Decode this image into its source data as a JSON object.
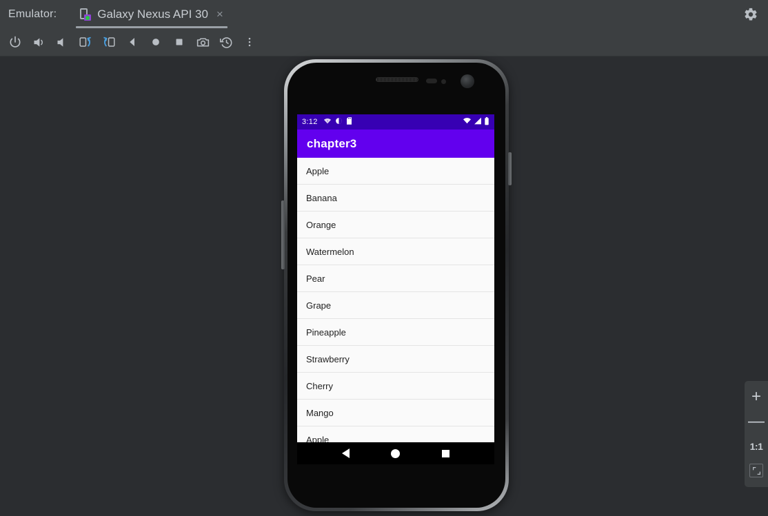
{
  "window": {
    "emulator_label": "Emulator:",
    "tab_title": "Galaxy Nexus API 30",
    "tab_close_glyph": "×",
    "device_icon_name": "device-running-icon",
    "settings_icon_name": "gear-icon"
  },
  "toolbar": {
    "buttons": [
      {
        "name": "power-button",
        "tooltip": "Power"
      },
      {
        "name": "volume-up-button",
        "tooltip": "Volume Up"
      },
      {
        "name": "volume-down-button",
        "tooltip": "Volume Down"
      },
      {
        "name": "rotate-left-button",
        "tooltip": "Rotate Left"
      },
      {
        "name": "rotate-right-button",
        "tooltip": "Rotate Right"
      },
      {
        "name": "back-button",
        "tooltip": "Back"
      },
      {
        "name": "home-button",
        "tooltip": "Home"
      },
      {
        "name": "overview-button",
        "tooltip": "Overview"
      },
      {
        "name": "screenshot-button",
        "tooltip": "Take Screenshot"
      },
      {
        "name": "record-history-button",
        "tooltip": "Record and Playback"
      },
      {
        "name": "more-options-button",
        "tooltip": "More"
      }
    ]
  },
  "device": {
    "status_bar": {
      "clock": "3:12",
      "left_icons": [
        "wifi-unknown-icon",
        "do-not-disturb-icon",
        "sd-card-icon"
      ],
      "right_icons": [
        "wifi-no-internet-icon",
        "cellular-signal-icon",
        "battery-icon"
      ],
      "background_color": "#3700b3"
    },
    "app_bar": {
      "title": "chapter3",
      "background_color": "#6200ee",
      "text_color": "#ffffff"
    },
    "list": {
      "items": [
        "Apple",
        "Banana",
        "Orange",
        "Watermelon",
        "Pear",
        "Grape",
        "Pineapple",
        "Strawberry",
        "Cherry",
        "Mango",
        "Apple"
      ],
      "background_color": "#fafafa",
      "divider_color": "#e4e4e4"
    },
    "nav_bar": {
      "keys": [
        {
          "name": "nav-back-key",
          "label": "Back"
        },
        {
          "name": "nav-home-key",
          "label": "Home"
        },
        {
          "name": "nav-recents-key",
          "label": "Recents"
        }
      ]
    }
  },
  "zoom_controls": {
    "zoom_in": "+",
    "zoom_out": "—",
    "actual_size": "1:1",
    "fit_icon_name": "fit-to-screen-icon"
  },
  "colors": {
    "chrome_background": "#3c3f41",
    "canvas_background": "#2b2d30",
    "accent_purple": "#6200ee",
    "status_purple": "#3700b3",
    "running_green": "#28c840"
  }
}
